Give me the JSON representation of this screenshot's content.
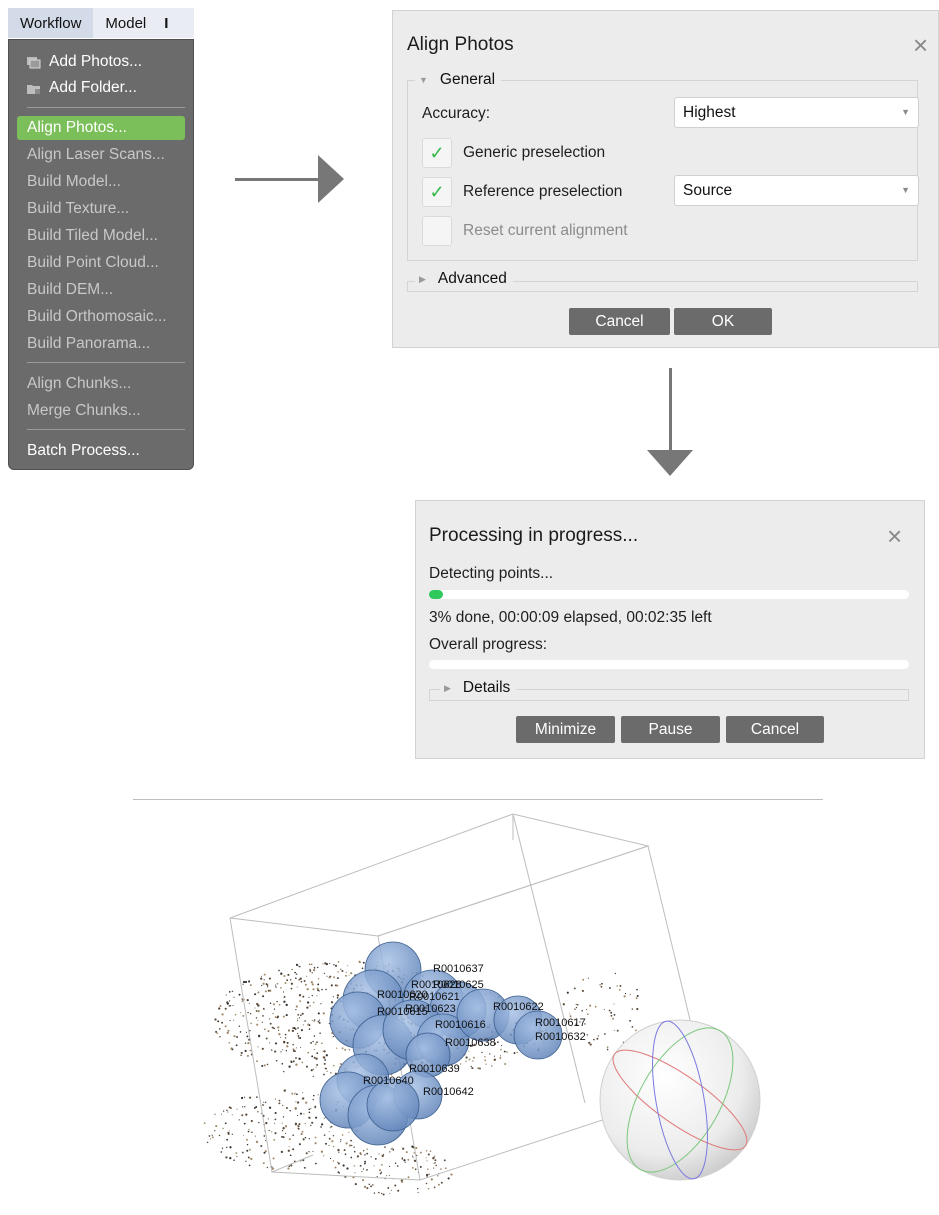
{
  "menubar": {
    "items": [
      "Workflow",
      "Model",
      "I"
    ],
    "active": "Workflow"
  },
  "menu": {
    "items": [
      {
        "label": "Add Photos...",
        "icon": "photos-icon",
        "enabled": true
      },
      {
        "label": "Add Folder...",
        "icon": "folder-icon",
        "enabled": true
      },
      {
        "label": "Align Photos...",
        "enabled": true,
        "selected": true
      },
      {
        "label": "Align Laser Scans...",
        "enabled": false
      },
      {
        "label": "Build Model...",
        "enabled": false
      },
      {
        "label": "Build Texture...",
        "enabled": false
      },
      {
        "label": "Build Tiled Model...",
        "enabled": false
      },
      {
        "label": "Build Point Cloud...",
        "enabled": false
      },
      {
        "label": "Build DEM...",
        "enabled": false
      },
      {
        "label": "Build Orthomosaic...",
        "enabled": false
      },
      {
        "label": "Build Panorama...",
        "enabled": false
      },
      {
        "label": "Align Chunks...",
        "enabled": false
      },
      {
        "label": "Merge Chunks...",
        "enabled": false
      },
      {
        "label": "Batch Process...",
        "enabled": true
      }
    ]
  },
  "align_dialog": {
    "title": "Align Photos",
    "general_label": "General",
    "accuracy_label": "Accuracy:",
    "accuracy_value": "Highest",
    "generic_preselection_label": "Generic preselection",
    "generic_preselection_checked": true,
    "reference_preselection_label": "Reference preselection",
    "reference_preselection_checked": true,
    "reference_value": "Source",
    "reset_label": "Reset current alignment",
    "reset_checked": false,
    "advanced_label": "Advanced",
    "cancel_label": "Cancel",
    "ok_label": "OK"
  },
  "progress_dialog": {
    "title": "Processing in progress...",
    "stage_label": "Detecting points...",
    "stage_progress": 0.03,
    "status_text": "3% done, 00:00:09 elapsed, 00:02:35 left",
    "overall_label": "Overall progress:",
    "overall_progress": 0.0,
    "details_label": "Details",
    "minimize_label": "Minimize",
    "pause_label": "Pause",
    "cancel_label": "Cancel"
  },
  "viewport": {
    "camera_labels": [
      "R0010637",
      "R0010628",
      "R0010625",
      "R0010620",
      "R0010621",
      "R0010622",
      "R0010623",
      "R0010615",
      "R0010616",
      "R0010617",
      "R0010632",
      "R0010638",
      "R0010639",
      "R0010640",
      "R0010642"
    ]
  },
  "colors": {
    "accent_green": "#7bbf5a",
    "progress_green": "#2ec95a",
    "button_gray": "#6b6b6b",
    "camera_blue": "#7a9ccc"
  }
}
